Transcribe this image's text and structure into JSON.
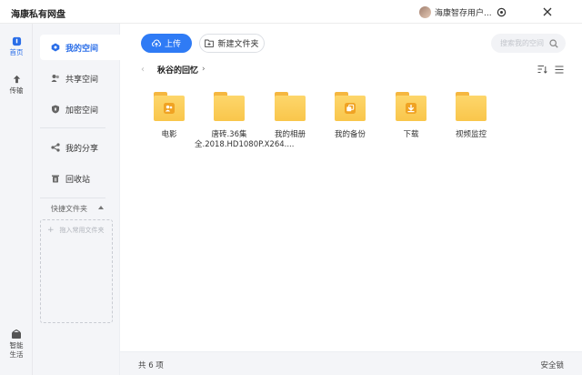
{
  "app": {
    "title": "海康私有网盘"
  },
  "user": {
    "name": "海康智存用户..."
  },
  "window_icons": [
    "user-avatar-icon",
    "settings-icon",
    "close-icon"
  ],
  "leftbar": {
    "items": [
      {
        "label": "首页",
        "icon": "home-icon",
        "active": true
      },
      {
        "label": "传输",
        "icon": "transfer-icon",
        "active": false
      }
    ],
    "bottom": {
      "label_line1": "智能",
      "label_line2": "生活",
      "icon": "smart-life-icon"
    }
  },
  "sidebar": {
    "items": [
      {
        "label": "我的空间",
        "icon": "my-space-icon",
        "active": true
      },
      {
        "label": "共享空间",
        "icon": "shared-space-icon",
        "active": false
      },
      {
        "label": "加密空间",
        "icon": "encrypted-space-icon",
        "active": false
      },
      {
        "label": "我的分享",
        "icon": "share-icon",
        "active": false
      },
      {
        "label": "回收站",
        "icon": "trash-icon",
        "active": false
      }
    ],
    "quick": {
      "title": "快捷文件夹",
      "hint": "拖入常用文件夹"
    }
  },
  "toolbar": {
    "upload_label": "上传",
    "new_folder_label": "新建文件夹",
    "search_placeholder": "搜索我的空间"
  },
  "breadcrumb": {
    "current": "秋谷的回忆"
  },
  "files": [
    {
      "name": "电影",
      "emblem": "people-icon"
    },
    {
      "name": "唐砖.36集全.2018.HD1080P.X264....",
      "emblem": ""
    },
    {
      "name": "我的相册",
      "emblem": ""
    },
    {
      "name": "我的备份",
      "emblem": "copy-icon"
    },
    {
      "name": "下载",
      "emblem": "download-icon"
    },
    {
      "name": "视频监控",
      "emblem": ""
    }
  ],
  "status": {
    "count": "共 6 项",
    "lock": "安全锁"
  },
  "colors": {
    "accent": "#2f7bf5",
    "folder": "#fbcd58",
    "folder_tab": "#f5b740"
  }
}
